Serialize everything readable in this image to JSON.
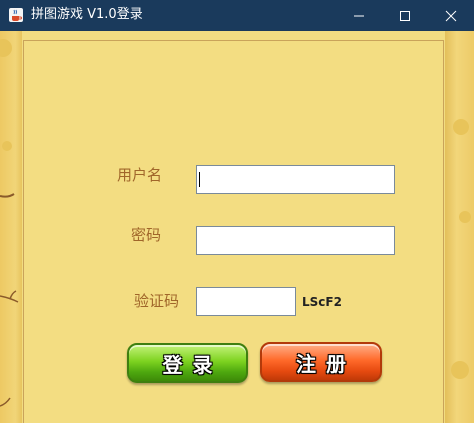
{
  "window": {
    "title": "拼图游戏 V1.0登录"
  },
  "form": {
    "username_label": "用户名",
    "username_value": "",
    "password_label": "密码",
    "password_value": "",
    "captcha_label": "验证码",
    "captcha_value": "",
    "captcha_code": "LScF2"
  },
  "buttons": {
    "login_label": "登录",
    "register_label": "注册"
  },
  "icons": {
    "app": "java-coffee-icon",
    "minimize": "minimize-icon",
    "maximize": "maximize-icon",
    "close": "close-icon"
  },
  "colors": {
    "titlebar": "#1a3a5c",
    "background": "#f2dd82",
    "label": "#a0662a",
    "login_button": "#7ed320",
    "register_button": "#ff6a2a"
  }
}
